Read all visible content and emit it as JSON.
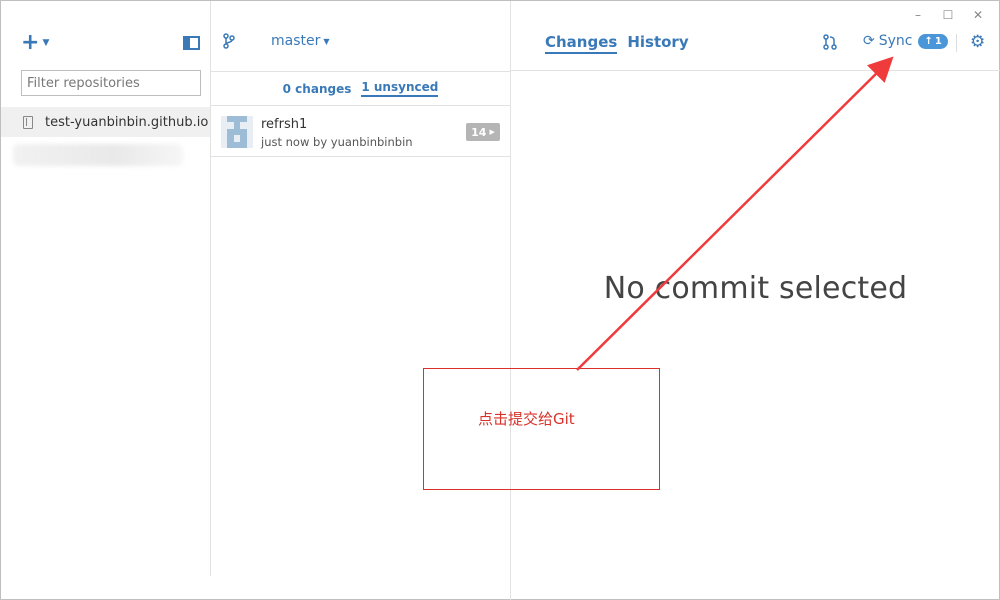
{
  "window": {
    "minimize": "–",
    "maximize": "☐",
    "close": "✕"
  },
  "sidebar": {
    "add_label": "+",
    "filter_placeholder": "Filter repositories",
    "repos": [
      {
        "name": "test-yuanbinbin.github.io",
        "selected": true
      }
    ]
  },
  "branch": {
    "name": "master"
  },
  "subtabs": {
    "changes": "0 changes",
    "unsynced": "1 unsynced"
  },
  "commits": [
    {
      "title": "refrsh1",
      "meta": "just now by yuanbinbinbin",
      "badge": "14"
    }
  ],
  "header": {
    "tab_changes": "Changes",
    "tab_history": "History",
    "sync_label": "Sync",
    "sync_badge": "1"
  },
  "main": {
    "empty_message": "No commit selected"
  },
  "annotation": {
    "text": "点击提交给Git",
    "color": "#d8322a"
  },
  "colors": {
    "accent": "#3a79b8",
    "annotation": "#d8322a"
  }
}
